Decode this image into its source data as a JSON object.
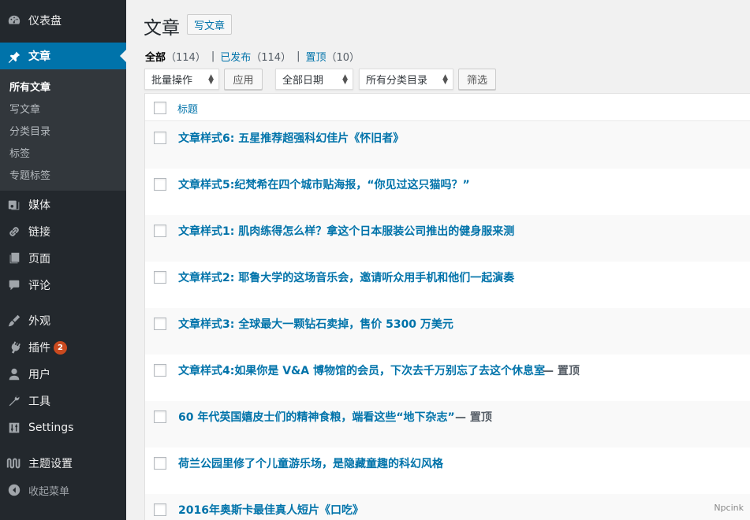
{
  "sidebar": {
    "menu": [
      {
        "label": "仪表盘",
        "icon": "dashboard-icon"
      },
      {
        "label": "文章",
        "icon": "pin-icon",
        "active": true
      },
      {
        "label": "媒体",
        "icon": "media-icon"
      },
      {
        "label": "链接",
        "icon": "link-icon"
      },
      {
        "label": "页面",
        "icon": "page-icon"
      },
      {
        "label": "评论",
        "icon": "comment-icon"
      },
      {
        "label": "外观",
        "icon": "brush-icon"
      },
      {
        "label": "插件",
        "icon": "plugin-icon",
        "badge": "2"
      },
      {
        "label": "用户",
        "icon": "user-icon"
      },
      {
        "label": "工具",
        "icon": "wrench-icon"
      },
      {
        "label": "Settings",
        "icon": "settings-icon"
      },
      {
        "label": "主题设置",
        "icon": "theme-icon"
      },
      {
        "label": "收起菜单",
        "icon": "collapse-icon"
      }
    ],
    "submenu": [
      "所有文章",
      "写文章",
      "分类目录",
      "标签",
      "专题标签"
    ]
  },
  "page": {
    "title": "文章",
    "add_new": "写文章"
  },
  "views": {
    "all": {
      "label": "全部",
      "count": "（114）"
    },
    "published": {
      "label": "已发布",
      "count": "（114）"
    },
    "sticky": {
      "label": "置顶",
      "count": "（10）"
    },
    "sep": "|"
  },
  "filters": {
    "bulk_action": "批量操作",
    "apply": "应用",
    "dates": "全部日期",
    "categories": "所有分类目录",
    "filter": "筛选"
  },
  "table": {
    "column_title": "标题",
    "rows": [
      {
        "title": "文章样式6: 五星推荐超强科幻佳片《怀旧者》",
        "state": ""
      },
      {
        "title": "文章样式5:纪梵希在四个城市贴海报，“你见过这只猫吗？”",
        "state": ""
      },
      {
        "title": "文章样式1: 肌肉练得怎么样？拿这个日本服装公司推出的健身服来测",
        "state": ""
      },
      {
        "title": "文章样式2: 耶鲁大学的这场音乐会，邀请听众用手机和他们一起演奏",
        "state": ""
      },
      {
        "title": "文章样式3: 全球最大一颗钻石卖掉，售价 5300 万美元",
        "state": ""
      },
      {
        "title": "文章样式4:如果你是 V&A 博物馆的会员，下次去千万别忘了去这个休息室",
        "state": "— 置顶"
      },
      {
        "title": "60 年代英国嬉皮士们的精神食粮，端看这些“地下杂志”",
        "state": "— 置顶"
      },
      {
        "title": "荷兰公园里修了个儿童游乐场，是隐藏童趣的科幻风格",
        "state": ""
      },
      {
        "title": "2016年奥斯卡最佳真人短片《口吃》",
        "state": ""
      }
    ]
  },
  "watermark": "Npcink",
  "colors": {
    "sidebar": "#23282d",
    "accent": "#0073aa",
    "badge": "#ca4a1f"
  }
}
